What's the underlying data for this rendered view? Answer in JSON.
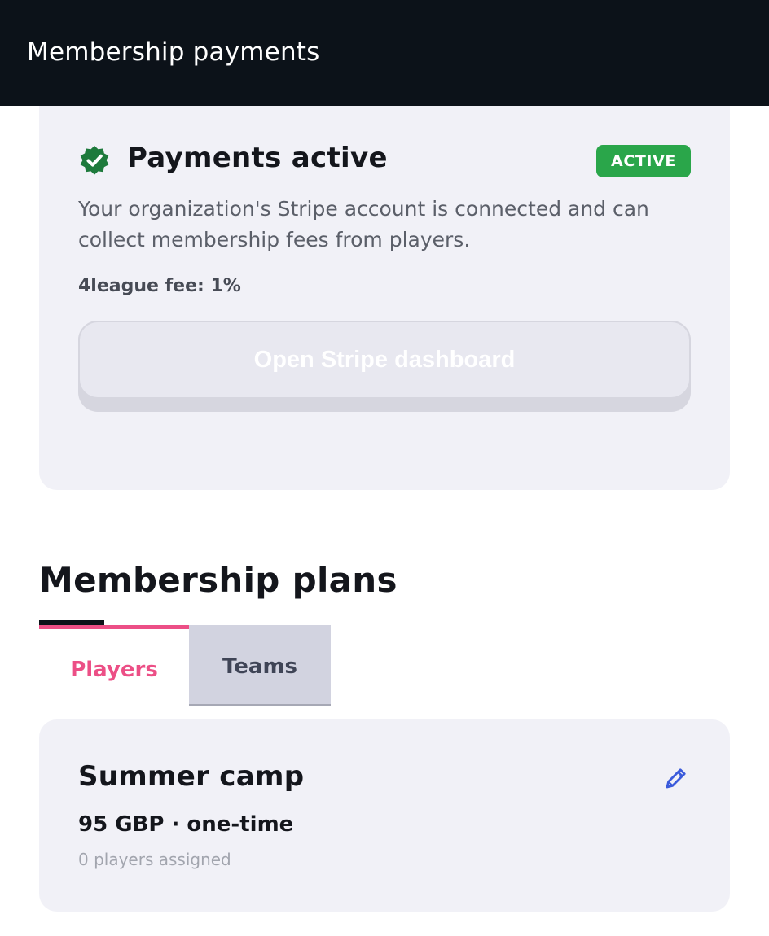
{
  "header": {
    "title": "Membership payments"
  },
  "payments": {
    "status_title": "Payments active",
    "status_badge": "ACTIVE",
    "description": "Your organization's Stripe account is connected and can collect membership fees from players.",
    "fee_label": "4league fee: 1%",
    "stripe_button_label": "Open Stripe dashboard",
    "status_icon": "verified-check-icon",
    "colors": {
      "badge": "#2aa64a",
      "icon": "#1e7a3c"
    }
  },
  "plans": {
    "title": "Membership plans",
    "tabs": [
      {
        "label": "Players",
        "active": true
      },
      {
        "label": "Teams",
        "active": false
      }
    ],
    "items": [
      {
        "name": "Summer camp",
        "price": "95 GBP · one-time",
        "assigned": "0 players assigned",
        "edit_icon": "pencil-icon"
      }
    ],
    "colors": {
      "active_tab": "#ec4f86",
      "edit_icon": "#3b5bdb"
    }
  }
}
